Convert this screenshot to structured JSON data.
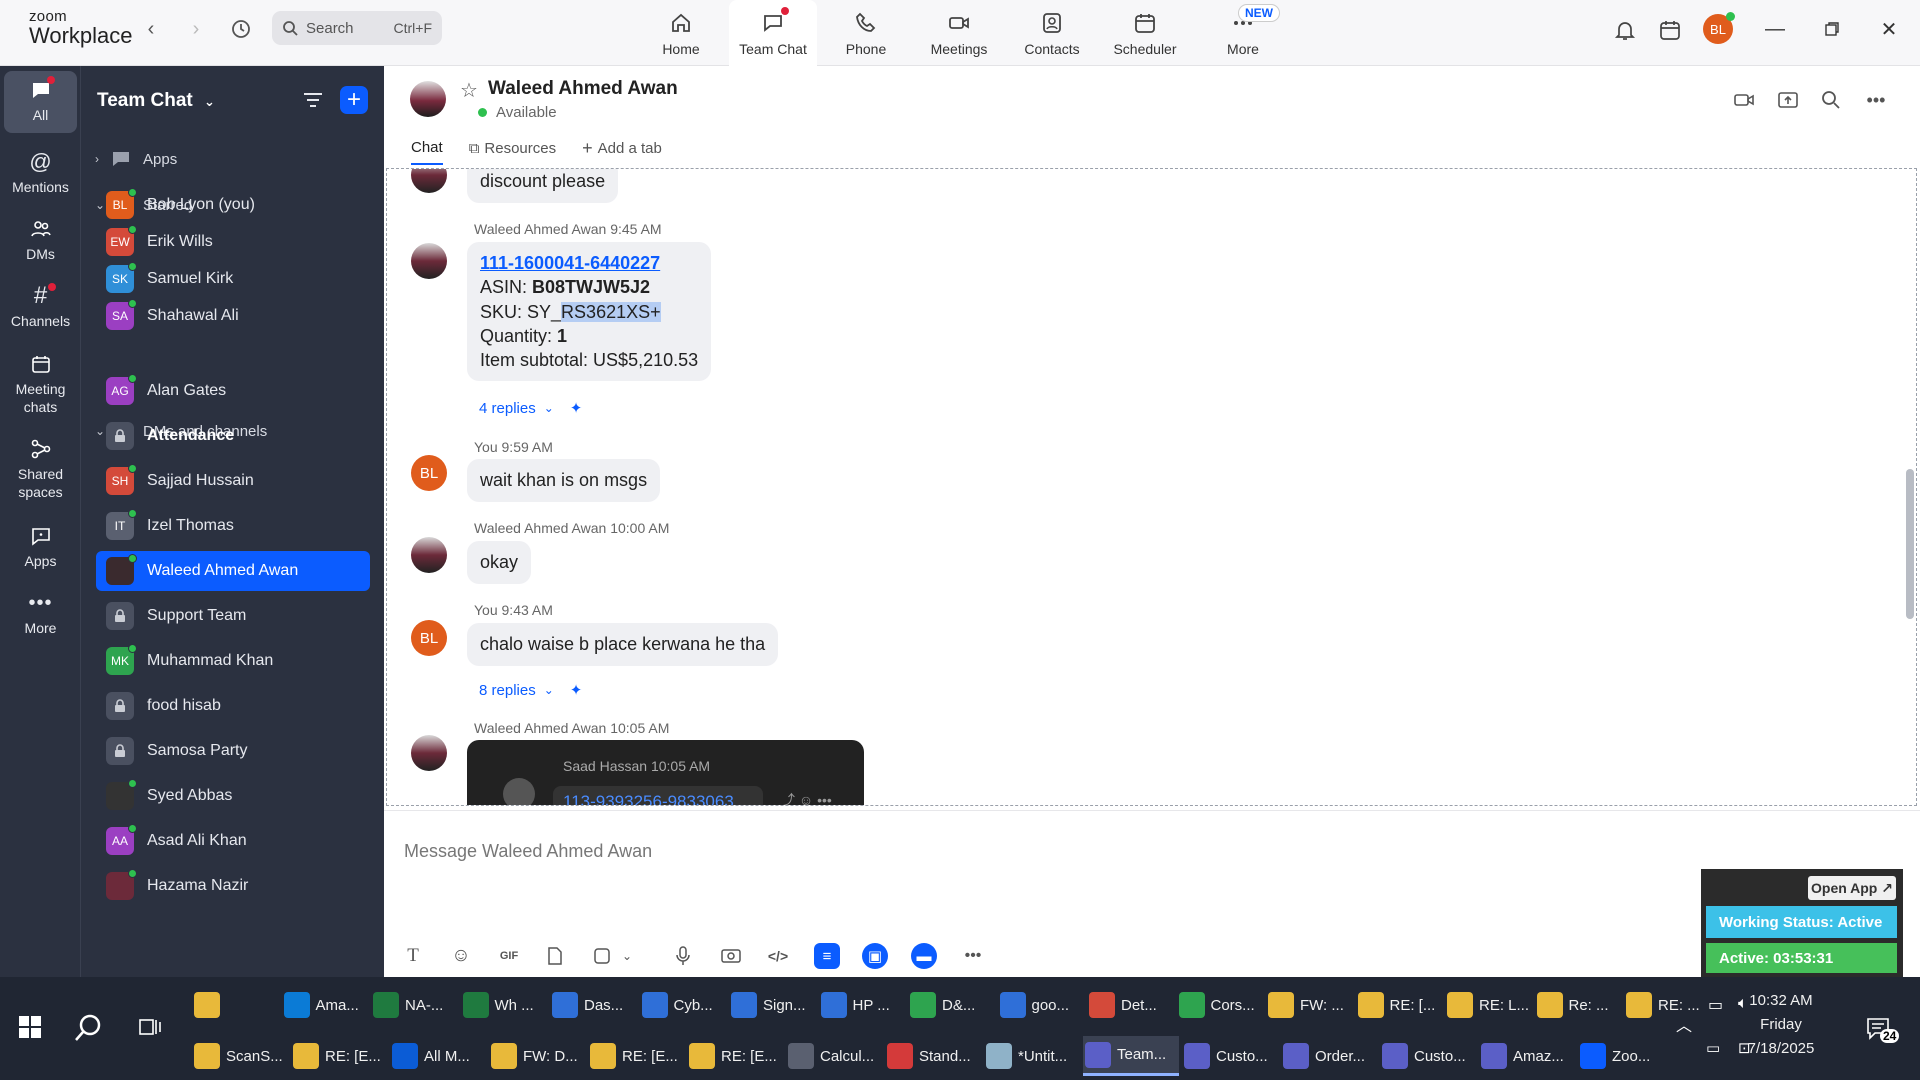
{
  "app": {
    "logo_line1": "zoom",
    "logo_line2": "Workplace",
    "search_placeholder": "Search",
    "search_shortcut": "Ctrl+F",
    "user_initials": "BL",
    "new_badge": "NEW"
  },
  "nav": [
    {
      "label": "Home",
      "icon": "home-icon"
    },
    {
      "label": "Team Chat",
      "icon": "chat-icon"
    },
    {
      "label": "Phone",
      "icon": "phone-icon"
    },
    {
      "label": "Meetings",
      "icon": "video-icon"
    },
    {
      "label": "Contacts",
      "icon": "contacts-icon"
    },
    {
      "label": "Scheduler",
      "icon": "calendar-icon"
    },
    {
      "label": "More",
      "icon": "more-icon"
    }
  ],
  "rail": [
    {
      "label": "All"
    },
    {
      "label": "Mentions"
    },
    {
      "label": "DMs"
    },
    {
      "label": "Channels"
    },
    {
      "label": "Meeting chats"
    },
    {
      "label": "Shared spaces"
    },
    {
      "label": "Apps"
    },
    {
      "label": "More"
    }
  ],
  "sidebar": {
    "title": "Team Chat",
    "sections": {
      "apps": "Apps",
      "starred": "Starred",
      "dms": "DMs and channels"
    },
    "starred": [
      {
        "initials": "BL",
        "name": "Bob Lyon (you)",
        "color": "#e05c1c"
      },
      {
        "initials": "EW",
        "name": "Erik Wills",
        "color": "#d44a3a"
      },
      {
        "initials": "SK",
        "name": "Samuel Kirk",
        "color": "#2f8fd8"
      },
      {
        "initials": "SA",
        "name": "Shahawal Ali",
        "color": "#9b3fc2"
      }
    ],
    "dms": [
      {
        "initials": "AG",
        "name": "Alan Gates",
        "color": "#9b3fc2"
      },
      {
        "initials": "",
        "name": "Attendance",
        "color": "#4a5060"
      },
      {
        "initials": "SH",
        "name": "Sajjad Hussain",
        "color": "#d44a3a"
      },
      {
        "initials": "IT",
        "name": "Izel Thomas",
        "color": "#5a6070"
      },
      {
        "initials": "",
        "name": "Waleed Ahmed Awan",
        "color": "#3a2a2e"
      },
      {
        "initials": "",
        "name": "Support Team",
        "color": "#4a5060"
      },
      {
        "initials": "MK",
        "name": "Muhammad Khan",
        "color": "#2ea44f"
      },
      {
        "initials": "",
        "name": "food hisab",
        "color": "#4a5060"
      },
      {
        "initials": "",
        "name": "Samosa Party",
        "color": "#4a5060"
      },
      {
        "initials": "",
        "name": "Syed Abbas",
        "color": "#333333"
      },
      {
        "initials": "AA",
        "name": "Asad Ali Khan",
        "color": "#9b3fc2"
      },
      {
        "initials": "",
        "name": "Hazama Nazir",
        "color": "#6c2a3a"
      }
    ]
  },
  "chat": {
    "name": "Waleed Ahmed Awan",
    "status": "Available",
    "tabs": [
      "Chat",
      "Resources",
      "Add a tab"
    ],
    "composer_placeholder": "Message Waleed Ahmed Awan"
  },
  "messages": {
    "m0_text": "discount please",
    "m1_meta": "Waleed Ahmed Awan 9:45 AM",
    "m1_link": "111-1600041-6440227",
    "m1_asin_label": "ASIN: ",
    "m1_asin": "B08TWJW5J2",
    "m1_sku_label": "SKU: SY_",
    "m1_sku": "RS3621XS+",
    "m1_qty_label": "Quantity: ",
    "m1_qty": "1",
    "m1_subtotal": "Item subtotal: US$5,210.53",
    "m1_replies": "4 replies",
    "m2_meta": "You 9:59 AM",
    "m2_text": "wait khan is on msgs",
    "m3_meta": "Waleed Ahmed Awan 10:00 AM",
    "m3_text": "okay",
    "m4_meta": "You 9:43 AM",
    "m4_text": "chalo waise b place kerwana he tha",
    "m4_replies": "8 replies",
    "m5_meta": "Waleed Ahmed Awan 10:05 AM",
    "m5_fwd_meta": "Saad Hassan 10:05 AM",
    "m5_fwd_link": "113-9393256-9833063"
  },
  "widget": {
    "open_app": "Open App ↗",
    "working_status": "Working Status: Active",
    "active_time": "Active: 03:53:31"
  },
  "taskbar": {
    "row1": [
      {
        "label": "",
        "color": "#e8b93a"
      },
      {
        "label": "Ama...",
        "color": "#0b7bd6"
      },
      {
        "label": "NA-...",
        "color": "#1f7a3f"
      },
      {
        "label": "Wh ...",
        "color": "#1f7a3f"
      },
      {
        "label": "Das...",
        "color": "#2f6fd8"
      },
      {
        "label": "Cyb...",
        "color": "#2f6fd8"
      },
      {
        "label": "Sign...",
        "color": "#2f6fd8"
      },
      {
        "label": "HP ...",
        "color": "#2f6fd8"
      },
      {
        "label": "D&...",
        "color": "#2ea44f"
      },
      {
        "label": "goo...",
        "color": "#2f6fd8"
      },
      {
        "label": "Det...",
        "color": "#d44a3a"
      },
      {
        "label": "Cors...",
        "color": "#2ea44f"
      },
      {
        "label": "FW: ...",
        "color": "#e8b93a"
      },
      {
        "label": "RE: [...",
        "color": "#e8b93a"
      },
      {
        "label": "RE: L...",
        "color": "#e8b93a"
      },
      {
        "label": "Re: ...",
        "color": "#e8b93a"
      },
      {
        "label": "RE: ...",
        "color": "#e8b93a"
      }
    ],
    "row2": [
      {
        "label": "ScanS...",
        "color": "#e8b93a"
      },
      {
        "label": "RE: [E...",
        "color": "#e8b93a"
      },
      {
        "label": "All M...",
        "color": "#0b5cd6"
      },
      {
        "label": "FW: D...",
        "color": "#e8b93a"
      },
      {
        "label": "RE: [E...",
        "color": "#e8b93a"
      },
      {
        "label": "RE: [E...",
        "color": "#e8b93a"
      },
      {
        "label": "Calcul...",
        "color": "#5a6070"
      },
      {
        "label": "Stand...",
        "color": "#d43a3a"
      },
      {
        "label": "*Untit...",
        "color": "#8fb2c8"
      },
      {
        "label": "Team...",
        "color": "#5b5fc7"
      },
      {
        "label": "Custo...",
        "color": "#5b5fc7"
      },
      {
        "label": "Order...",
        "color": "#5b5fc7"
      },
      {
        "label": "Custo...",
        "color": "#5b5fc7"
      },
      {
        "label": "Amaz...",
        "color": "#5b5fc7"
      },
      {
        "label": "Zoo...",
        "color": "#0b5cff"
      }
    ],
    "time": "10:32 AM",
    "day": "Friday",
    "date": "7/18/2025",
    "notif_count": "24"
  }
}
